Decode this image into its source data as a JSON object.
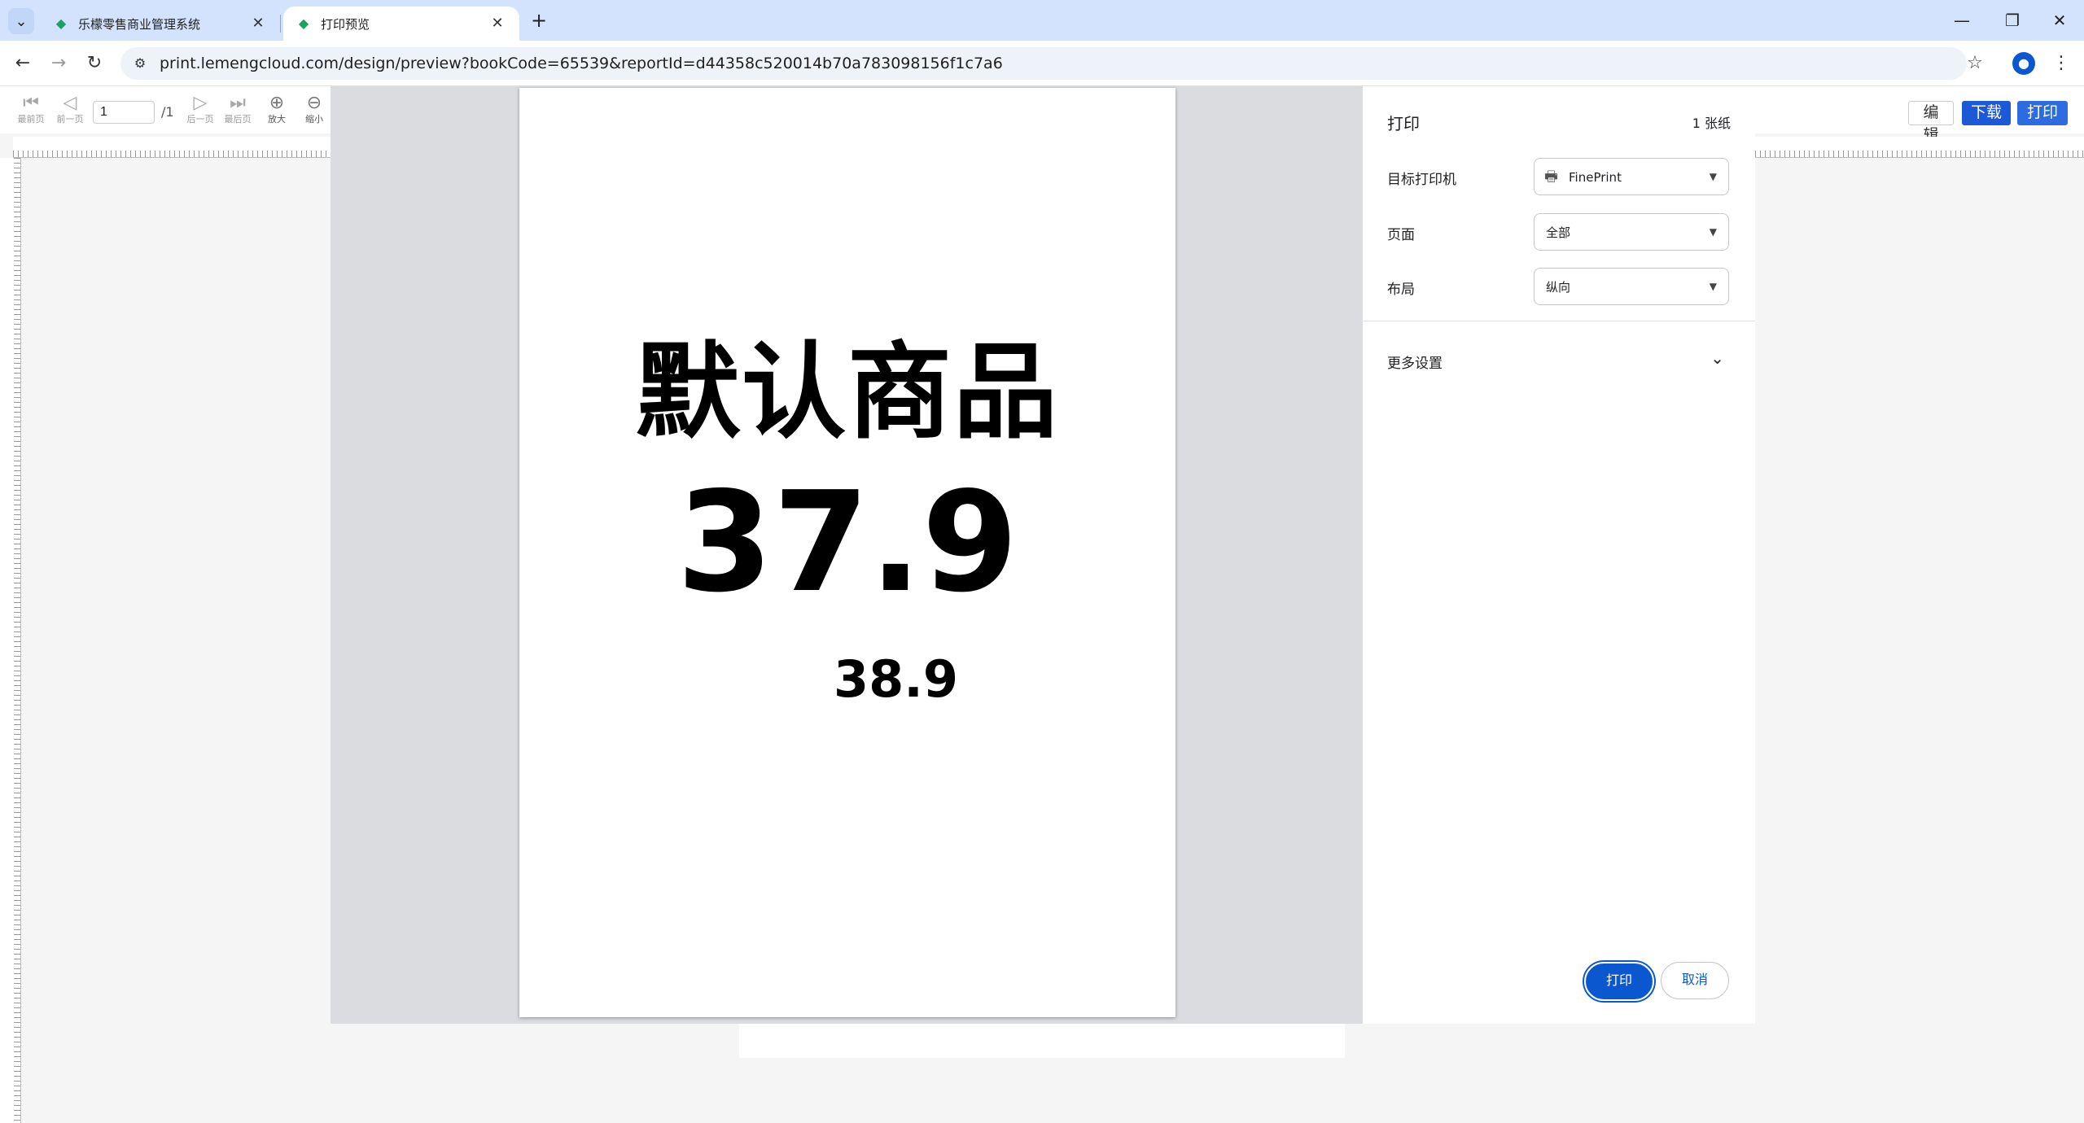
{
  "browser": {
    "tabs": [
      {
        "title": "乐檬零售商业管理系统",
        "active": false
      },
      {
        "title": "打印预览",
        "active": true
      }
    ],
    "url": "print.lemengcloud.com/design/preview?bookCode=65539&reportId=d44358c520014b70a783098156f1c7a6"
  },
  "toolbar": {
    "first_label": "最前页",
    "prev_label": "前一页",
    "next_label": "后一页",
    "last_label": "最后页",
    "zoomin_label": "放大",
    "zoomout_label": "缩小",
    "page_value": "1",
    "page_total": "/1",
    "edit_label": "编辑",
    "download_label": "下载",
    "print_label": "打印"
  },
  "paper": {
    "product_name": "默认商品",
    "price_main": "37.9",
    "price_sub": "38.9"
  },
  "print_panel": {
    "title": "打印",
    "sheets": "1 张纸",
    "printer_label": "目标打印机",
    "printer_value": "FinePrint",
    "pages_label": "页面",
    "pages_value": "全部",
    "layout_label": "布局",
    "layout_value": "纵向",
    "more_settings": "更多设置",
    "print_button": "打印",
    "cancel_button": "取消"
  },
  "colors": {
    "accent": "#0b57d0",
    "tabbar": "#d3e3fd",
    "download_btn": "#1b59d6"
  }
}
